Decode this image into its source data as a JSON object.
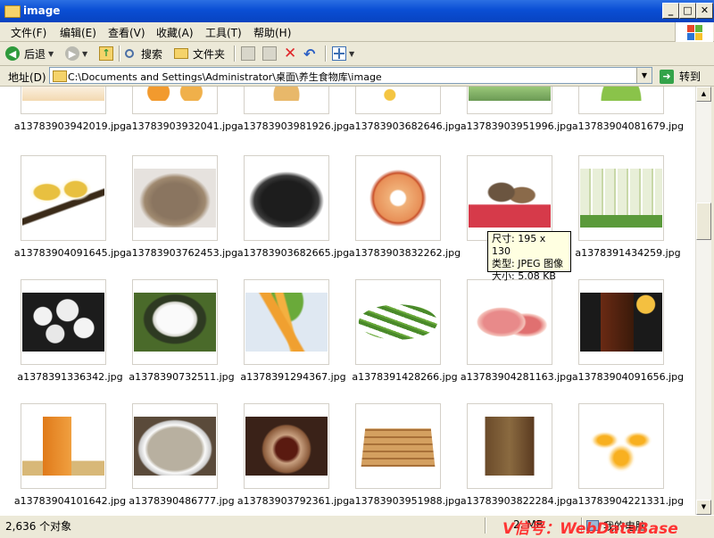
{
  "window": {
    "title": "image"
  },
  "menu": [
    {
      "label": "文件(F)"
    },
    {
      "label": "编辑(E)"
    },
    {
      "label": "查看(V)"
    },
    {
      "label": "收藏(A)"
    },
    {
      "label": "工具(T)"
    },
    {
      "label": "帮助(H)"
    }
  ],
  "toolbar": {
    "back_label": "后退",
    "search_label": "搜索",
    "folders_label": "文件夹",
    "icons": [
      "back-arrow-icon",
      "forward-arrow-icon",
      "folder-up-icon",
      "search-icon",
      "folders-icon",
      "move-to-icon",
      "copy-to-icon",
      "delete-icon",
      "undo-icon",
      "views-icon"
    ]
  },
  "address": {
    "label": "地址(D)",
    "value": "C:\\Documents and Settings\\Administrator\\桌面\\养生食物库\\image",
    "go_label": "转到"
  },
  "files": [
    {
      "name": "a13783903942019.jpg"
    },
    {
      "name": "a13783903932041.jpg"
    },
    {
      "name": "a13783903981926.jpg"
    },
    {
      "name": "a13783903682646.jpg"
    },
    {
      "name": "a13783903951996.jpg"
    },
    {
      "name": "a13783904081679.jpg"
    },
    {
      "name": "a13783904091645.jpg"
    },
    {
      "name": "a13783903762453.jpg"
    },
    {
      "name": "a13783903682665.jpg"
    },
    {
      "name": "a13783903832262.jpg"
    },
    {
      "name": "a1378"
    },
    {
      "name": "a1378391434259.jpg"
    },
    {
      "name": "a1378391336342.jpg"
    },
    {
      "name": "a1378390732511.jpg"
    },
    {
      "name": "a1378391294367.jpg"
    },
    {
      "name": "a1378391428266.jpg"
    },
    {
      "name": "a13783904281163.jpg"
    },
    {
      "name": "a13783904091656.jpg"
    },
    {
      "name": "a13783904101642.jpg"
    },
    {
      "name": "a1378390486777.jpg"
    },
    {
      "name": "a13783903792361.jpg"
    },
    {
      "name": "a13783903951988.jpg"
    },
    {
      "name": "a13783903822284.jpg"
    },
    {
      "name": "a13783904221331.jpg"
    }
  ],
  "tooltip": {
    "size": "尺寸: 195 x 130",
    "type": "类型: JPEG 图像",
    "filesize": "大小: 5.08 KB"
  },
  "status": {
    "count": "2,636 个对象",
    "size": "2. MB",
    "location": "我的电脑"
  },
  "watermark": "V信号：WebDataBase"
}
